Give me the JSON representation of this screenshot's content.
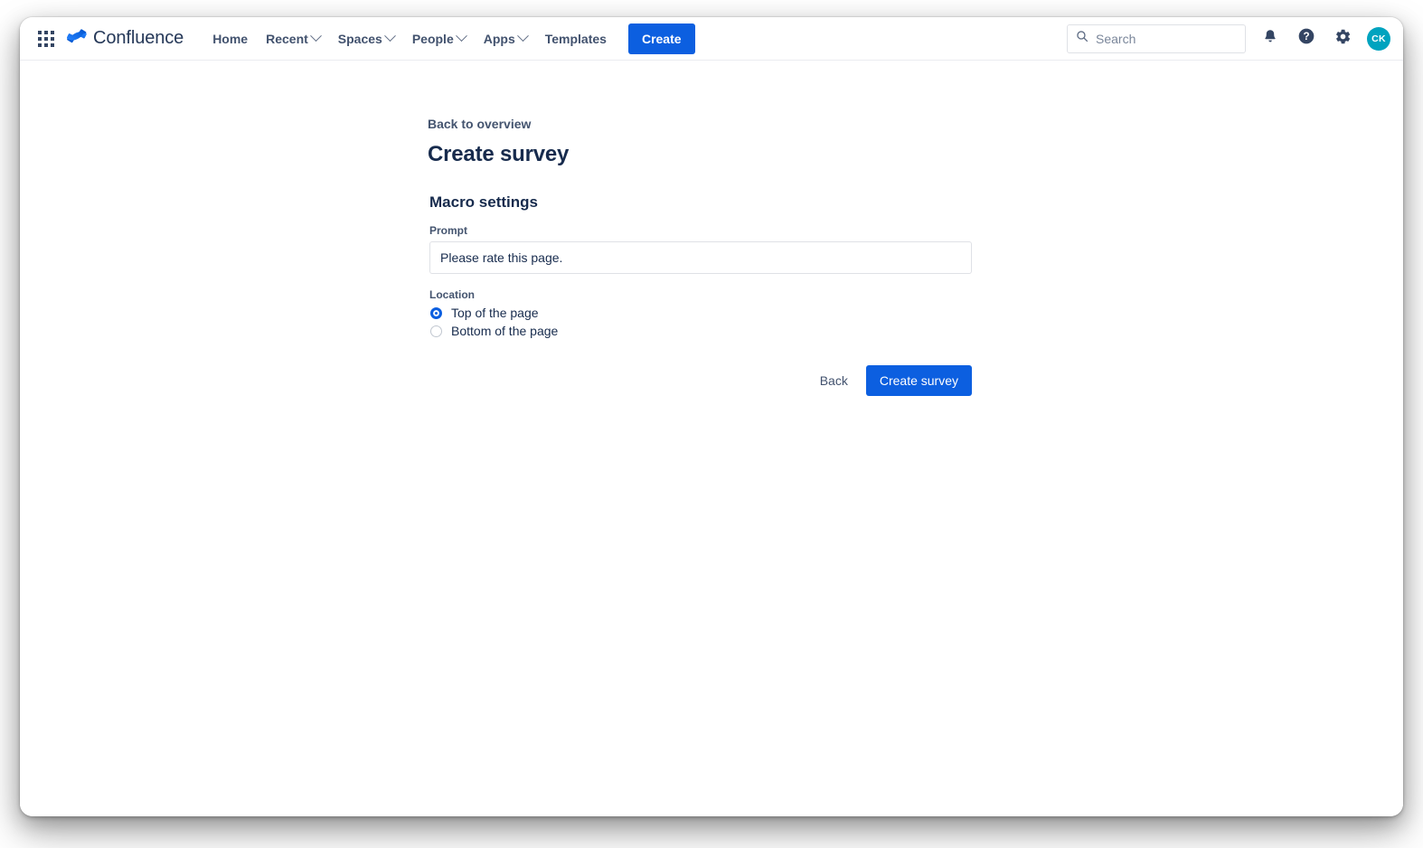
{
  "nav": {
    "app_switcher_icon": "grid-apps-icon",
    "brand_name": "Confluence",
    "brand_logo_icon": "confluence-logo-icon",
    "items": [
      {
        "label": "Home",
        "has_dropdown": false
      },
      {
        "label": "Recent",
        "has_dropdown": true
      },
      {
        "label": "Spaces",
        "has_dropdown": true
      },
      {
        "label": "People",
        "has_dropdown": true
      },
      {
        "label": "Apps",
        "has_dropdown": true
      },
      {
        "label": "Templates",
        "has_dropdown": false
      }
    ],
    "create_label": "Create",
    "search_placeholder": "Search",
    "search_value": "",
    "search_icon": "search-icon",
    "notifications_icon": "bell-icon",
    "help_icon": "question-circle-icon",
    "settings_icon": "gear-icon",
    "avatar_initials": "CK"
  },
  "main": {
    "back_link": "Back to overview",
    "page_title": "Create survey",
    "section_title": "Macro settings",
    "prompt": {
      "label": "Prompt",
      "value": "Please rate this page.",
      "placeholder": ""
    },
    "location": {
      "label": "Location",
      "selected": "Top of the page",
      "options": [
        {
          "label": "Top of the page",
          "checked": true
        },
        {
          "label": "Bottom of the page",
          "checked": false
        }
      ]
    },
    "actions": {
      "back_label": "Back",
      "submit_label": "Create survey"
    }
  },
  "colors": {
    "primary_blue": "#0c5fe0",
    "brand_blue": "#2684ff",
    "text_dark": "#172b4d",
    "text_muted": "#44546f",
    "avatar_teal": "#00a3bf",
    "border_grey": "#dfe1e6"
  }
}
